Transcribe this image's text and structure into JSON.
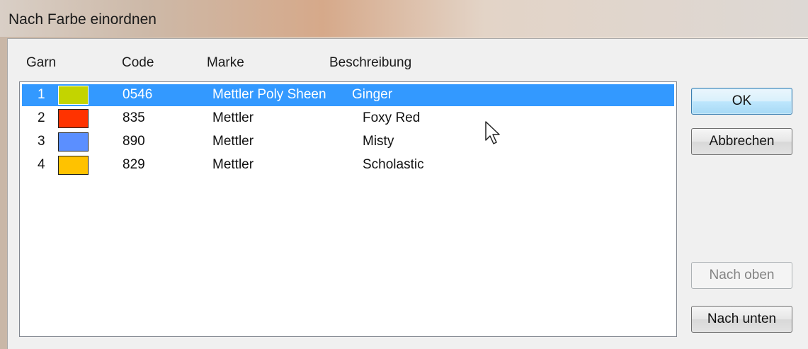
{
  "window": {
    "title": "Nach Farbe einordnen"
  },
  "columns": {
    "garn": "Garn",
    "code": "Code",
    "marke": "Marke",
    "beschreibung": "Beschreibung"
  },
  "rows": [
    {
      "num": "1",
      "color": "#c3d400",
      "code": "0546",
      "marke": "Mettler Poly Sheen",
      "beschreibung": "Ginger",
      "selected": true
    },
    {
      "num": "2",
      "color": "#ff3300",
      "code": "835",
      "marke": "Mettler",
      "beschreibung": "Foxy Red",
      "selected": false
    },
    {
      "num": "3",
      "color": "#5b8fff",
      "code": "890",
      "marke": "Mettler",
      "beschreibung": "Misty",
      "selected": false
    },
    {
      "num": "4",
      "color": "#ffc200",
      "code": "829",
      "marke": "Mettler",
      "beschreibung": "Scholastic",
      "selected": false
    }
  ],
  "buttons": {
    "ok": "OK",
    "abbrechen": "Abbrechen",
    "nach_oben": "Nach oben",
    "nach_unten": "Nach unten"
  }
}
